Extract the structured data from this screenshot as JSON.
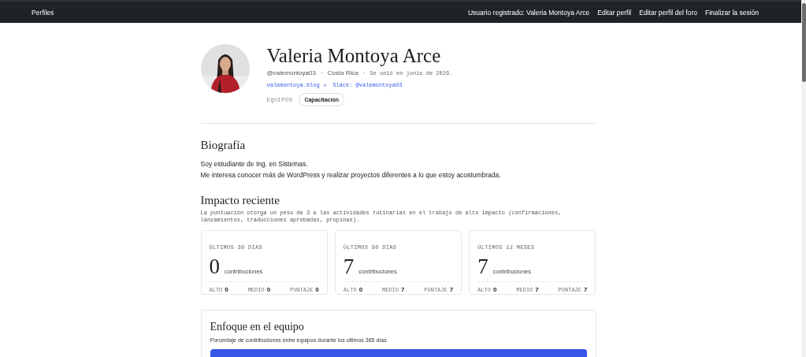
{
  "topbar": {
    "title": "Perfiles",
    "links": [
      "Usuario registrado: Valeria Montoya Arce",
      "Editar perfil",
      "Editar perfil del foro",
      "Finalizar la sesión"
    ]
  },
  "profile": {
    "avatar": {
      "kind": "picture"
    },
    "name": "Valeria Montoya Arce",
    "username": "@valemontoya03",
    "separator": "·",
    "location": "Costa Rica",
    "joined": "Se unió en junio de 2026.",
    "website": "valemontoya.blog",
    "website_arrow": "↗",
    "slack": "Slack: @valemontoya03",
    "teams_label": "EQUIPOS",
    "teams": [
      "Capacitación"
    ]
  },
  "bio": {
    "heading": "Biografía",
    "lines": [
      "Soy estudiante de Ing. en Sistemas.",
      "Me interesa conocer más de WordPress y realizar proyectos diferentes a lo que estoy acostumbrada."
    ]
  },
  "impact": {
    "heading": "Impacto reciente",
    "description": "La puntuación otorga un peso de 3 a las actividades rutinarias en el trabajo de alto impacto (confirmaciones, lanzamientos, traducciones aprobadas, propinas).",
    "cards": [
      {
        "period": "ÚLTIMOS 30 DÍAS",
        "count": "0",
        "unit": "contribuciones",
        "stats": [
          {
            "label": "ALTO",
            "value": "0"
          },
          {
            "label": "MEDIO",
            "value": "0"
          },
          {
            "label": "PUNTAJE",
            "value": "0"
          }
        ]
      },
      {
        "period": "ÚLTIMOS 90 DÍAS",
        "count": "7",
        "unit": "contribuciones",
        "stats": [
          {
            "label": "ALTO",
            "value": "0"
          },
          {
            "label": "MEDIO",
            "value": "7"
          },
          {
            "label": "PUNTAJE",
            "value": "7"
          }
        ]
      },
      {
        "period": "ÚLTIMOS 12 MESES",
        "count": "7",
        "unit": "contribuciones",
        "stats": [
          {
            "label": "ALTO",
            "value": "0"
          },
          {
            "label": "MEDIO",
            "value": "7"
          },
          {
            "label": "PUNTAJE",
            "value": "7"
          }
        ]
      }
    ]
  },
  "team_focus": {
    "heading": "Enfoque en el equipo",
    "description": "Porcentaje de contribuciones entre equipos durante los últimos 365 días"
  }
}
